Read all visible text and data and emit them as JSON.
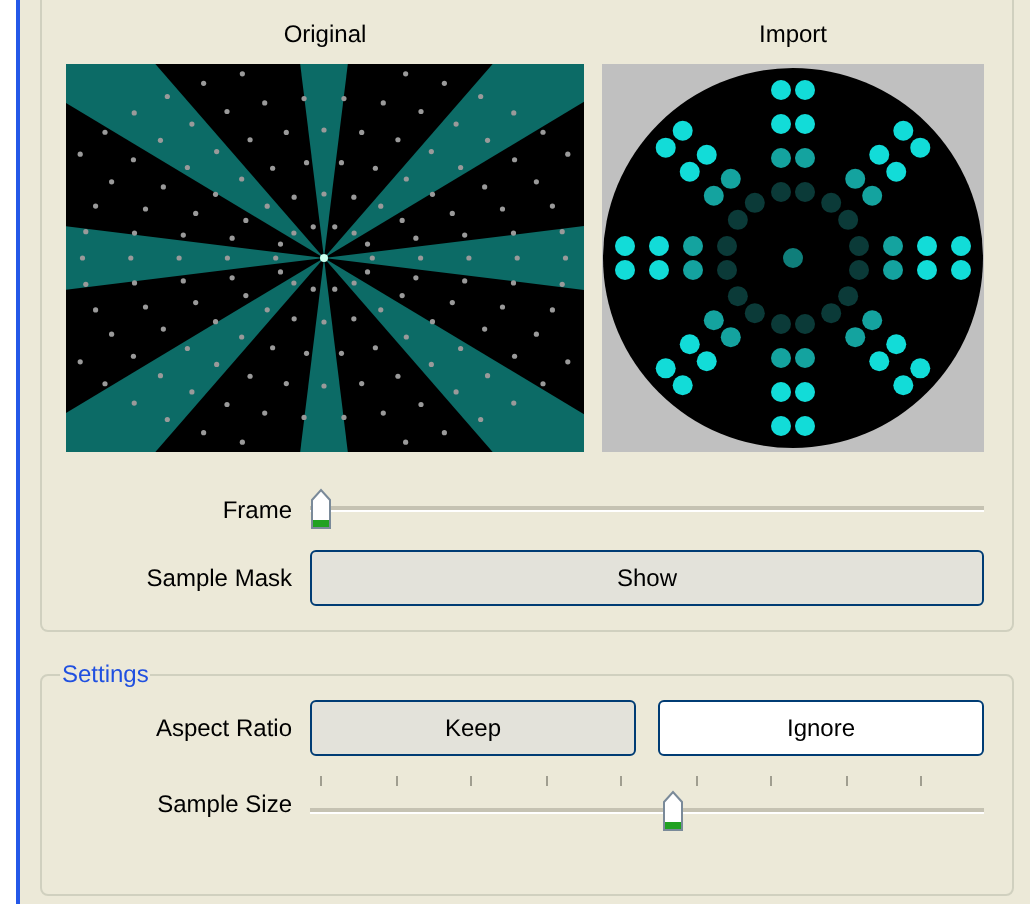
{
  "preview": {
    "original_label": "Original",
    "import_label": "Import"
  },
  "frame": {
    "label": "Frame",
    "level": 0
  },
  "sample_mask": {
    "label": "Sample Mask",
    "button": "Show"
  },
  "settings": {
    "title": "Settings",
    "aspect_ratio": {
      "label": "Aspect Ratio",
      "options": [
        {
          "label": "Keep",
          "selected": true
        },
        {
          "label": "Ignore",
          "selected": false
        }
      ]
    },
    "sample_size": {
      "label": "Sample Size",
      "level": 0.54
    }
  }
}
